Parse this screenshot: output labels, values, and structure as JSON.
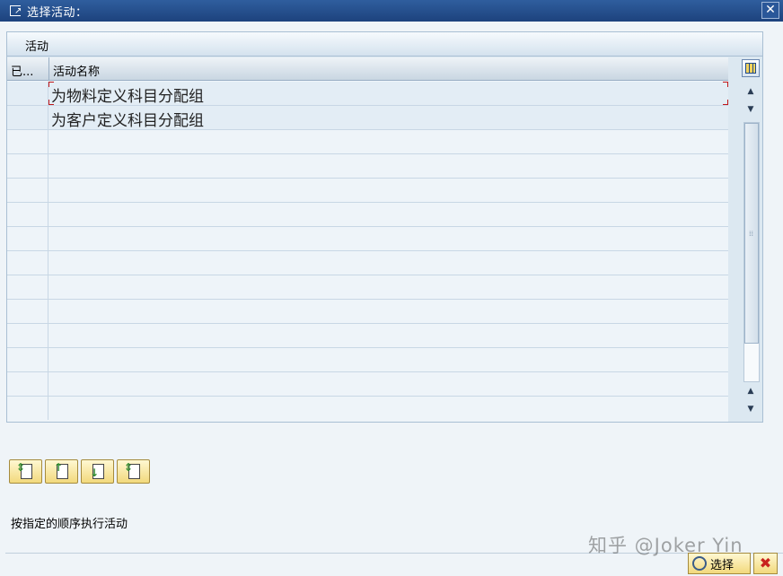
{
  "window": {
    "title": "选择活动：",
    "close_icon": "close-icon",
    "title_icon": "dialog-icon"
  },
  "group": {
    "title": "活动"
  },
  "table": {
    "columns": [
      "已...",
      "活动名称"
    ],
    "rows": [
      {
        "selected": "",
        "name": "为物料定义科目分配组"
      },
      {
        "selected": "",
        "name": "为客户定义科目分配组"
      },
      {
        "selected": "",
        "name": ""
      },
      {
        "selected": "",
        "name": ""
      },
      {
        "selected": "",
        "name": ""
      },
      {
        "selected": "",
        "name": ""
      },
      {
        "selected": "",
        "name": ""
      },
      {
        "selected": "",
        "name": ""
      },
      {
        "selected": "",
        "name": ""
      },
      {
        "selected": "",
        "name": ""
      },
      {
        "selected": "",
        "name": ""
      },
      {
        "selected": "",
        "name": ""
      },
      {
        "selected": "",
        "name": ""
      },
      {
        "selected": "",
        "name": ""
      }
    ]
  },
  "toolbar": {
    "buttons": [
      "select-all-icon",
      "move-up-icon",
      "move-down-icon",
      "deselect-all-icon"
    ]
  },
  "hint": "按指定的顺序执行活动",
  "watermark": "知乎 @Joker Yin",
  "footer": {
    "select_label": "选择",
    "cancel_icon": "cancel-icon"
  },
  "colors": {
    "title_bar": "#1d427d",
    "button_yellow": "#f2d97c",
    "focus_red": "#c0181b"
  }
}
